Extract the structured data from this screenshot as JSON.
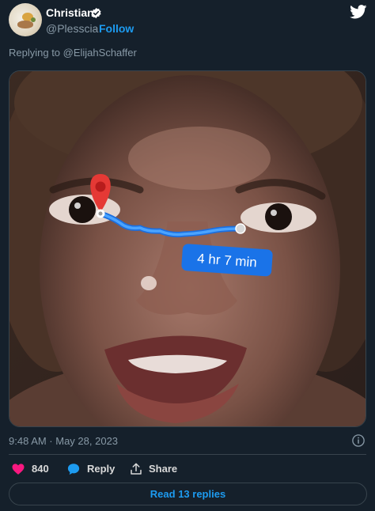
{
  "colors": {
    "background": "#15202b",
    "accent": "#1d9bf0",
    "muted": "#8899a6",
    "like": "#f91880",
    "divider": "#38444d"
  },
  "author": {
    "display_name": "Christian",
    "verified": true,
    "handle": "@Plesscia",
    "separator": "·",
    "follow_label": "Follow"
  },
  "reply_context": "Replying to @ElijahSchaffer",
  "media": {
    "description_icon": "map-pin-icon",
    "route_label": "4 hr 7 min"
  },
  "timestamp": "9:48 AM · May 28, 2023",
  "actions": {
    "likes": "840",
    "reply_label": "Reply",
    "share_label": "Share"
  },
  "read_replies_label": "Read 13 replies",
  "icons": [
    "twitter-logo",
    "verified-badge-icon",
    "info-icon",
    "heart-icon",
    "reply-bubble-icon",
    "share-icon"
  ]
}
